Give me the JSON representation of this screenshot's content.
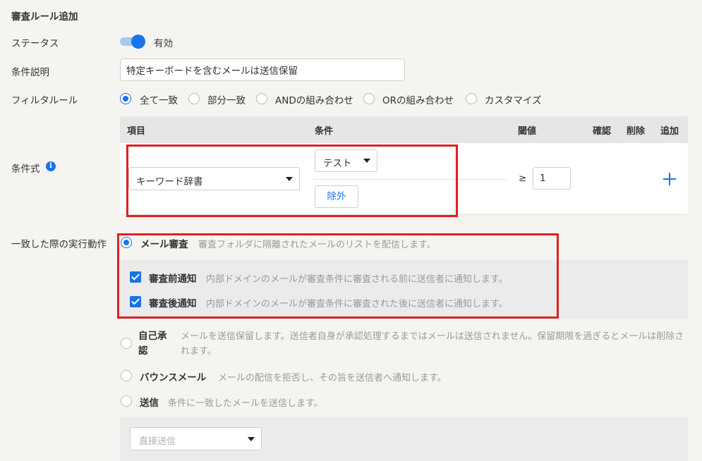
{
  "page_title": "審査ルール追加",
  "status": {
    "label": "ステータス",
    "toggle_on": true,
    "value_label": "有効"
  },
  "condition_description": {
    "label": "条件説明",
    "value": "特定キーボードを含むメールは送信保留"
  },
  "filter_rule": {
    "label": "フィルタルール",
    "options": [
      "全て一致",
      "部分一致",
      "ANDの組み合わせ",
      "ORの組み合わせ",
      "カスタマイズ"
    ],
    "selected": 0
  },
  "condition_expression": {
    "label": "条件式",
    "info_icon": "info-icon",
    "headers": {
      "item": "項目",
      "condition": "条件",
      "threshold": "閾値",
      "confirm": "確認",
      "delete": "削除",
      "add": "追加"
    },
    "row": {
      "item_value": "キーワード辞書",
      "condition_value": "テスト",
      "exclude_label": "除外",
      "operator": "≥",
      "threshold_value": "1"
    }
  },
  "match_action": {
    "label": "一致した際の実行動作",
    "options": [
      {
        "label": "メール審査",
        "description": "審査フォルダに隔離されたメールのリストを配信します。",
        "selected": true
      },
      {
        "label": "自己承認",
        "description": "メールを送信保留します。送信者自身が承認処理するまではメールは送信されません。保留期限を過ぎるとメールは削除されます。",
        "selected": false
      },
      {
        "label": "バウンスメール",
        "description": "メールの配信を拒否し、その旨を送信者へ通知します。",
        "selected": false
      },
      {
        "label": "送信",
        "description": "条件に一致したメールを送信します。",
        "selected": false
      }
    ],
    "checks": [
      {
        "label": "審査前通知",
        "description": "内部ドメインのメールが審査条件に審査される前に送信者に通知します。",
        "checked": true
      },
      {
        "label": "審査後通知",
        "description": "内部ドメインのメールが審査条件に審査された後に送信者に通知します。",
        "checked": true
      }
    ],
    "send_select_placeholder": "直接送信"
  }
}
